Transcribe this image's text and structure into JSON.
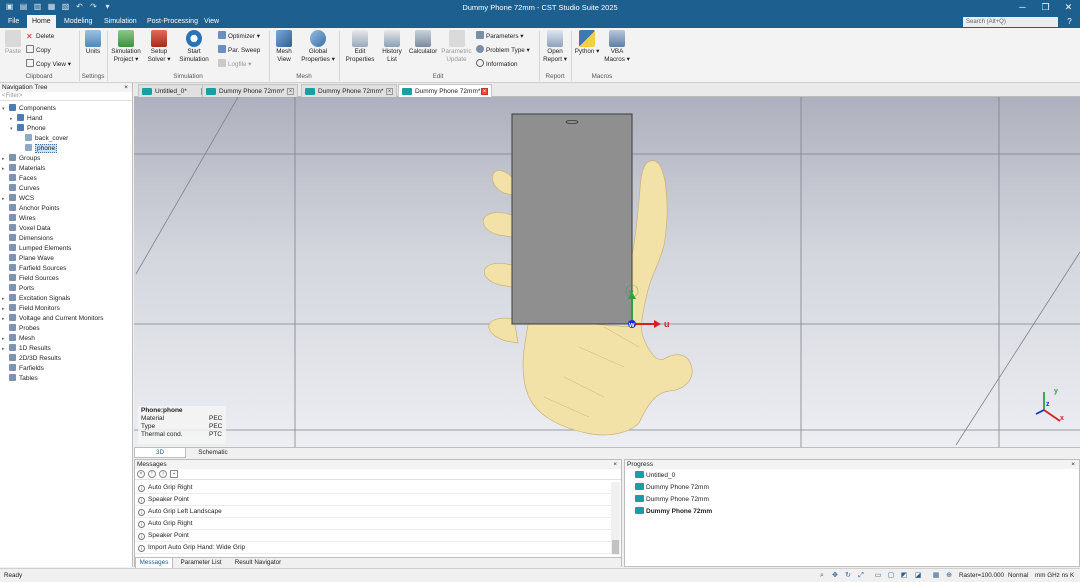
{
  "app": {
    "title": "Dummy Phone 72mm - CST Studio Suite 2025"
  },
  "quick_access": [
    "app-logo-icon",
    "save-icon",
    "save-all-icon",
    "print-icon",
    "folder-icon",
    "undo-icon",
    "redo-icon",
    "dropdown-icon"
  ],
  "menu": {
    "tabs": [
      "File",
      "Home",
      "Modeling",
      "Simulation",
      "Post-Processing",
      "View"
    ],
    "active": "Home",
    "search_placeholder": "Search (Alt+Q)",
    "help_glyph": "?"
  },
  "ribbon": {
    "clipboard": {
      "paste": "Paste",
      "delete": "Delete",
      "copy": "Copy",
      "copy_view": "Copy View",
      "group": "Clipboard"
    },
    "settings": {
      "units": "Units",
      "group": "Settings"
    },
    "simulation": {
      "project": "Simulation Project",
      "setup": "Setup Solver",
      "start": "Start Simulation",
      "optimizer": "Optimizer",
      "par_sweep": "Par. Sweep",
      "logfile": "Logfile",
      "group": "Simulation"
    },
    "mesh": {
      "mesh_view": "Mesh View",
      "global_props": "Global Properties",
      "group": "Mesh"
    },
    "edit": {
      "edit_props": "Edit Properties",
      "history": "History List",
      "calculator": "Calculator",
      "param_update": "Parametric Update",
      "parameters": "Parameters",
      "problem_type": "Problem Type",
      "information": "Information",
      "group": "Edit"
    },
    "report": {
      "open_report": "Open Report",
      "group": "Report"
    },
    "macros": {
      "python": "Python",
      "vba": "VBA Macros",
      "group": "Macros"
    }
  },
  "nav": {
    "title": "Navigation Tree",
    "close_glyph": "×",
    "filter_placeholder": "<Filter>",
    "items": [
      {
        "label": "Components",
        "expanded": true
      },
      {
        "label": "Hand",
        "expanded": false
      },
      {
        "label": "Phone",
        "expanded": true
      },
      {
        "label": "back_cover"
      },
      {
        "label": "phone",
        "selected": true
      },
      {
        "label": "Groups"
      },
      {
        "label": "Materials"
      },
      {
        "label": "Faces"
      },
      {
        "label": "Curves"
      },
      {
        "label": "WCS"
      },
      {
        "label": "Anchor Points"
      },
      {
        "label": "Wires"
      },
      {
        "label": "Voxel Data"
      },
      {
        "label": "Dimensions"
      },
      {
        "label": "Lumped Elements"
      },
      {
        "label": "Plane Wave"
      },
      {
        "label": "Farfield Sources"
      },
      {
        "label": "Field Sources"
      },
      {
        "label": "Ports"
      },
      {
        "label": "Excitation Signals"
      },
      {
        "label": "Field Monitors"
      },
      {
        "label": "Voltage and Current Monitors"
      },
      {
        "label": "Probes"
      },
      {
        "label": "Mesh"
      },
      {
        "label": "1D Results"
      },
      {
        "label": "2D/3D Results"
      },
      {
        "label": "Farfields"
      },
      {
        "label": "Tables"
      }
    ]
  },
  "doc_tabs": [
    {
      "label": "Untitled_0*",
      "active": false
    },
    {
      "label": "Dummy Phone 72mm*",
      "active": false
    },
    {
      "label": "Dummy Phone 72mm*",
      "active": false
    },
    {
      "label": "Dummy Phone 72mm*",
      "active": true
    }
  ],
  "viewport": {
    "axes": {
      "u": "u",
      "v": "v",
      "w": "w"
    },
    "triad": {
      "x": "x",
      "y": "y",
      "z": "z"
    },
    "props": {
      "header": "Phone:phone",
      "rows": [
        {
          "k": "Material",
          "v": "PEC"
        },
        {
          "k": "Type",
          "v": "PEC"
        },
        {
          "k": "Thermal cond.",
          "v": "PTC"
        }
      ]
    },
    "colors": {
      "phone": "#8f8f8f",
      "hand": "#f3e2a8",
      "u_axis": "#d42020",
      "v_axis": "#2ea043",
      "w_axis": "#1a2fd1"
    }
  },
  "view_tabs": [
    "3D",
    "Schematic"
  ],
  "messages": {
    "title": "Messages",
    "close_glyph": "×",
    "items": [
      "Auto Grip Right",
      "Speaker Point",
      "Auto Grip Left Landscape",
      "Auto Grip Right",
      "Speaker Point",
      "Import Auto Grip Hand: Wide Grip"
    ],
    "tabs": [
      "Messages",
      "Parameter List",
      "Result Navigator"
    ]
  },
  "progress": {
    "title": "Progress",
    "close_glyph": "×",
    "items": [
      {
        "label": "Untitled_0",
        "bold": false
      },
      {
        "label": "Dummy Phone 72mm",
        "bold": false
      },
      {
        "label": "Dummy Phone 72mm",
        "bold": false
      },
      {
        "label": "Dummy Phone 72mm",
        "bold": true
      }
    ]
  },
  "status": {
    "left": "Ready",
    "raster": "Raster=100.000",
    "mode": "Normal",
    "units": "mm  GHz  ns  K"
  }
}
